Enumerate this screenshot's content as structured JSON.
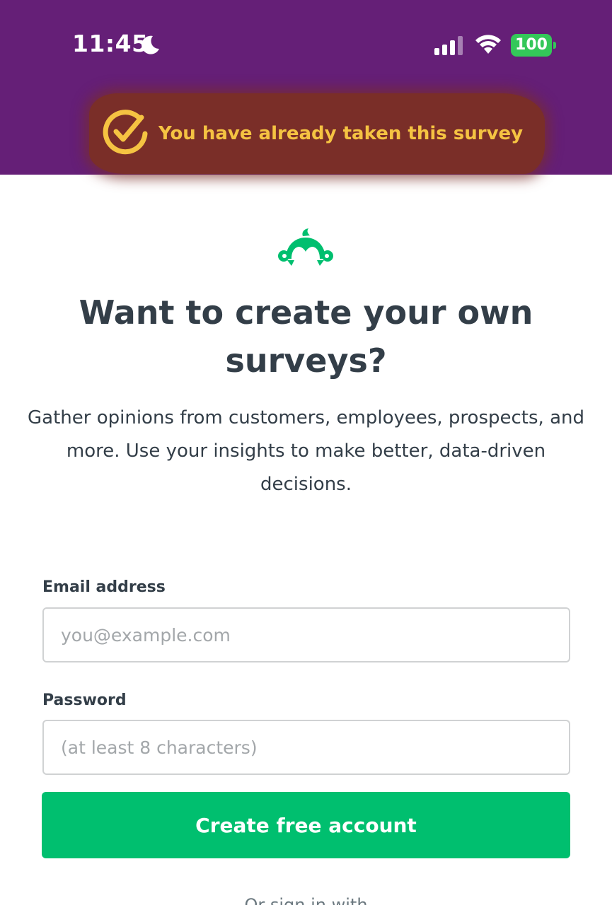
{
  "status_bar": {
    "time": "11:45",
    "battery": "100",
    "icons": [
      "moon-icon",
      "cellular-signal-icon",
      "wifi-icon",
      "battery-icon"
    ]
  },
  "notice": {
    "text": "You have already taken this survey",
    "icon": "check-circle-icon"
  },
  "brand": {
    "logo_icon": "surveymonkey-logo-icon"
  },
  "main": {
    "headline": "Want to create your own surveys?",
    "subtext": "Gather opinions from customers, employees, prospects, and more. Use your insights to make better, data-driven decisions."
  },
  "form": {
    "email": {
      "label": "Email address",
      "value": "",
      "placeholder": "you@example.com"
    },
    "password": {
      "label": "Password",
      "value": "",
      "placeholder": "(at least 8 characters)"
    },
    "submit_label": "Create free account",
    "signin_with": "Or sign in with"
  },
  "colors": {
    "header_bg": "#651f77",
    "notice_text": "#f5c342",
    "brand_green": "#00bf6f",
    "heading_text": "#333e48",
    "battery_green": "#34c759"
  }
}
